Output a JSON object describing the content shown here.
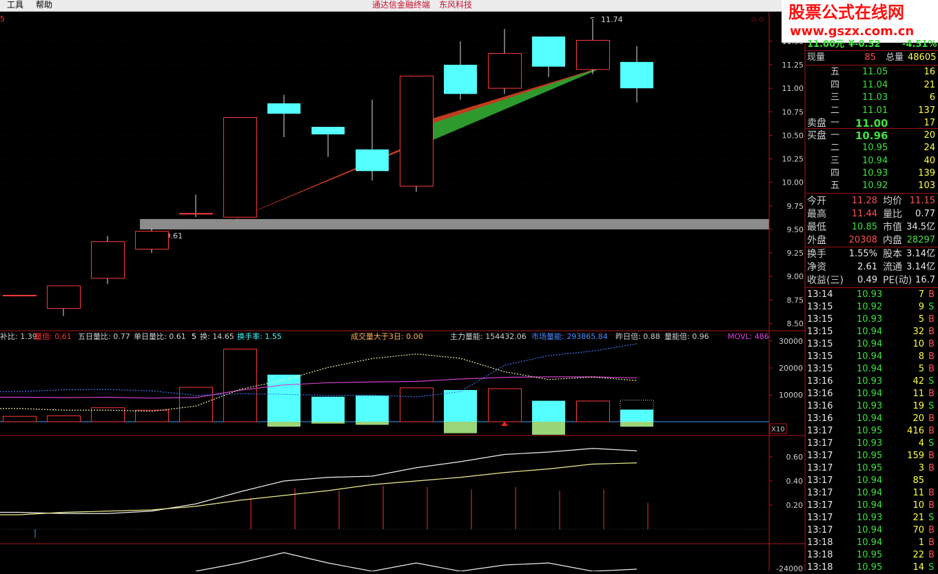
{
  "menu": {
    "tools": "工具",
    "help": "帮助",
    "app_title": "通达信金融终端",
    "vendor": "东风科技"
  },
  "watermark": {
    "line1": "股票公式在线网",
    "line2": "www.gszx.com.cn"
  },
  "chart_top_left_label": "5",
  "chart_data": [
    {
      "type": "candlestick",
      "y_axis_ticks": [
        "11.50",
        "11.25",
        "11.00",
        "10.75",
        "10.50",
        "10.25",
        "10.00",
        "9.75",
        "9.50",
        "9.25",
        "9.00",
        "8.75",
        "8.50"
      ],
      "ylim": [
        8.43,
        11.77
      ],
      "annotations": {
        "high_label": "11.74",
        "zone_label": "9.50 - 9.61",
        "zone": [
          9.5,
          9.61
        ]
      },
      "candles": [
        {
          "open": 8.8,
          "close": 8.8,
          "high": 8.8,
          "low": 8.8,
          "dir": "up"
        },
        {
          "open": 8.66,
          "close": 8.9,
          "high": 8.9,
          "low": 8.58,
          "dir": "up"
        },
        {
          "open": 8.98,
          "close": 9.37,
          "high": 9.43,
          "low": 8.92,
          "dir": "up"
        },
        {
          "open": 9.29,
          "close": 9.48,
          "high": 9.51,
          "low": 9.25,
          "dir": "up"
        },
        {
          "open": 9.67,
          "close": 9.67,
          "high": 9.87,
          "low": 9.63,
          "dir": "up"
        },
        {
          "open": 9.63,
          "close": 10.69,
          "high": 10.69,
          "low": 9.63,
          "dir": "up"
        },
        {
          "open": 10.84,
          "close": 10.73,
          "high": 10.93,
          "low": 10.48,
          "dir": "down"
        },
        {
          "open": 10.59,
          "close": 10.51,
          "high": 10.59,
          "low": 10.27,
          "dir": "down"
        },
        {
          "open": 10.35,
          "close": 10.12,
          "high": 10.88,
          "low": 10.02,
          "dir": "down"
        },
        {
          "open": 9.96,
          "close": 11.13,
          "high": 11.13,
          "low": 9.9,
          "dir": "up"
        },
        {
          "open": 11.25,
          "close": 10.94,
          "high": 11.5,
          "low": 10.88,
          "dir": "down"
        },
        {
          "open": 11.0,
          "close": 11.37,
          "high": 11.63,
          "low": 10.94,
          "dir": "up"
        },
        {
          "open": 11.55,
          "close": 11.23,
          "high": 11.55,
          "low": 11.12,
          "dir": "down"
        },
        {
          "open": 11.2,
          "close": 11.51,
          "high": 11.74,
          "low": 11.15,
          "dir": "up"
        },
        {
          "open": 11.28,
          "close": 11.0,
          "high": 11.45,
          "low": 10.85,
          "dir": "down"
        }
      ]
    },
    {
      "type": "bar",
      "header": [
        {
          "text": "补比: 1.39",
          "color": "#cfcfcf"
        },
        {
          "text": "量倍: 0.61",
          "color": "#ff3030"
        },
        {
          "text": "五日量比: 0.77",
          "color": "#cfcfcf"
        },
        {
          "text": "单日量比: 0.61",
          "color": "#cfcfcf"
        },
        {
          "text": "5",
          "color": "#ffffff"
        },
        {
          "text": "换: 14.65",
          "color": "#cfcfcf"
        },
        {
          "text": "换手率: 1.55",
          "color": "#40ffff"
        },
        {
          "text": "成交量大于3日: 0.00",
          "color": "#ffb050"
        },
        {
          "text": "主力量能: 154432.06",
          "color": "#cfcfcf"
        },
        {
          "text": "市场量能: 293865.84",
          "color": "#4a8cff"
        },
        {
          "text": "昨日倍: 0.88",
          "color": "#cfcfcf"
        },
        {
          "text": "量能倍: 0.96",
          "color": "#cfcfcf"
        },
        {
          "text": "MOVL: 486",
          "color": "#e040e0"
        }
      ],
      "y_axis_ticks": [
        "30000",
        "20000",
        "10000"
      ],
      "ylim": [
        0,
        30000
      ],
      "volume": [
        2000,
        2200,
        5200,
        4300,
        12800,
        27000,
        17500,
        9300,
        9700,
        12600,
        11800,
        12300,
        7800,
        7700,
        4500
      ],
      "dir": [
        "up",
        "up",
        "up",
        "up",
        "up",
        "up",
        "down",
        "down",
        "down",
        "up",
        "down",
        "up",
        "down",
        "up",
        "down"
      ],
      "neg": [
        0,
        0,
        0,
        0,
        0,
        0,
        1.6,
        0.6,
        1.0,
        0,
        3.7,
        0,
        4.2,
        0,
        1.6
      ],
      "ma_purple": [
        9100,
        9000,
        9100,
        8800,
        9000,
        11700,
        13700,
        14500,
        14800,
        15000,
        15900,
        16500,
        16700,
        16700,
        16300
      ],
      "ma_yellow": [
        4900,
        4300,
        4300,
        3900,
        5800,
        12000,
        15500,
        20200,
        23500,
        25200,
        23600,
        18600,
        15700,
        16600,
        15300
      ],
      "ma_blue": [
        11200,
        11900,
        12000,
        11500,
        9800,
        10400,
        10200,
        9800,
        9900,
        9200,
        11200,
        21000,
        24600,
        26300,
        29000
      ],
      "x10_label": "X10"
    },
    {
      "type": "line",
      "y_axis_ticks": [
        "0.60",
        "0.40",
        "0.20"
      ],
      "ylim": [
        0,
        0.76
      ],
      "line_white": [
        0.14,
        0.13,
        0.13,
        0.15,
        0.21,
        0.31,
        0.4,
        0.43,
        0.44,
        0.51,
        0.56,
        0.62,
        0.64,
        0.67,
        0.65
      ],
      "line_yellow": [
        0.12,
        0.14,
        0.15,
        0.16,
        0.19,
        0.24,
        0.28,
        0.32,
        0.37,
        0.4,
        0.43,
        0.47,
        0.5,
        0.54,
        0.55
      ],
      "bars": [
        0,
        0,
        0,
        0,
        0,
        0.26,
        0.34,
        0.32,
        0.36,
        0.35,
        0.33,
        0.35,
        0.32,
        0.33,
        0.22
      ]
    },
    {
      "type": "line",
      "y_axis_ticks": [
        "-24000"
      ],
      "line_white": [
        0,
        0,
        0,
        0,
        0,
        0.4,
        0.9,
        0.4,
        0,
        0.4,
        0,
        0.3,
        0.4,
        0,
        0.1
      ]
    }
  ],
  "quote": {
    "top_partial": {
      "price": "11.00元",
      "change": "¥-0.52",
      "pct": "-4.51%"
    },
    "now_label": "现量",
    "now_val": "85",
    "total_label": "总量",
    "total_val": "48605",
    "sell_label": "卖盘",
    "buy_label": "买盘",
    "asks": [
      {
        "lvl": "五",
        "price": "11.05",
        "vol": "16"
      },
      {
        "lvl": "四",
        "price": "11.04",
        "vol": "21"
      },
      {
        "lvl": "三",
        "price": "11.03",
        "vol": "6"
      },
      {
        "lvl": "二",
        "price": "11.01",
        "vol": "137"
      },
      {
        "lvl": "一",
        "price": "11.00",
        "vol": "17"
      }
    ],
    "bids": [
      {
        "lvl": "一",
        "price": "10.96",
        "vol": "20"
      },
      {
        "lvl": "二",
        "price": "10.95",
        "vol": "24"
      },
      {
        "lvl": "三",
        "price": "10.94",
        "vol": "40"
      },
      {
        "lvl": "四",
        "price": "10.93",
        "vol": "139"
      },
      {
        "lvl": "五",
        "price": "10.92",
        "vol": "103"
      }
    ],
    "stats": [
      {
        "l1": "今开",
        "v1": "11.28",
        "c1": "red",
        "l2": "均价",
        "v2": "11.15",
        "c2": "red"
      },
      {
        "l1": "最高",
        "v1": "11.44",
        "c1": "red",
        "l2": "量比",
        "v2": "0.77",
        "c2": "wht"
      },
      {
        "l1": "最低",
        "v1": "10.85",
        "c1": "grn",
        "l2": "市值",
        "v2": "34.5亿",
        "c2": "wht"
      },
      {
        "l1": "外盘",
        "v1": "20308",
        "c1": "red",
        "l2": "内盘",
        "v2": "28297",
        "c2": "grn"
      }
    ],
    "stats2": [
      {
        "l1": "换手",
        "v1": "1.55%",
        "l2": "股本",
        "v2": "3.14亿"
      },
      {
        "l1": "净资",
        "v1": "2.61",
        "l2": "流通",
        "v2": "3.14亿"
      },
      {
        "l1": "收益(三)",
        "v1": "0.49",
        "l2": "PE(动)",
        "v2": "16.7"
      }
    ],
    "ticks": [
      {
        "t": "13:14",
        "p": "10.93",
        "v": "7",
        "s": "B"
      },
      {
        "t": "13:15",
        "p": "10.92",
        "v": "9",
        "s": "S"
      },
      {
        "t": "13:15",
        "p": "10.93",
        "v": "5",
        "s": "B"
      },
      {
        "t": "13:15",
        "p": "10.94",
        "v": "32",
        "s": "B"
      },
      {
        "t": "13:15",
        "p": "10.94",
        "v": "10",
        "s": "B"
      },
      {
        "t": "13:15",
        "p": "10.94",
        "v": "8",
        "s": "B"
      },
      {
        "t": "13:15",
        "p": "10.94",
        "v": "5",
        "s": "B"
      },
      {
        "t": "13:16",
        "p": "10.93",
        "v": "42",
        "s": "S"
      },
      {
        "t": "13:16",
        "p": "10.94",
        "v": "11",
        "s": "B"
      },
      {
        "t": "13:16",
        "p": "10.93",
        "v": "19",
        "s": "S"
      },
      {
        "t": "13:16",
        "p": "10.94",
        "v": "20",
        "s": "B"
      },
      {
        "t": "13:17",
        "p": "10.95",
        "v": "416",
        "s": "B"
      },
      {
        "t": "13:17",
        "p": "10.93",
        "v": "4",
        "s": "S"
      },
      {
        "t": "13:17",
        "p": "10.95",
        "v": "159",
        "s": "B"
      },
      {
        "t": "13:17",
        "p": "10.95",
        "v": "3",
        "s": "B"
      },
      {
        "t": "13:17",
        "p": "10.94",
        "v": "85",
        "s": ""
      },
      {
        "t": "13:17",
        "p": "10.94",
        "v": "11",
        "s": "B"
      },
      {
        "t": "13:17",
        "p": "10.94",
        "v": "10",
        "s": "B"
      },
      {
        "t": "13:17",
        "p": "10.93",
        "v": "21",
        "s": "S"
      },
      {
        "t": "13:17",
        "p": "10.94",
        "v": "70",
        "s": "B"
      },
      {
        "t": "13:18",
        "p": "10.94",
        "v": "1",
        "s": "B"
      },
      {
        "t": "13:18",
        "p": "10.95",
        "v": "22",
        "s": "B"
      },
      {
        "t": "13:18",
        "p": "10.95",
        "v": "14",
        "s": "S"
      }
    ]
  },
  "colors": {
    "up": "#ff3a3a",
    "down": "#54ffff",
    "vol_neg": "#9ad57a",
    "zone": "#8c8c8c",
    "trend_red": "#c03a20",
    "trend_green": "#2e9a2e"
  }
}
